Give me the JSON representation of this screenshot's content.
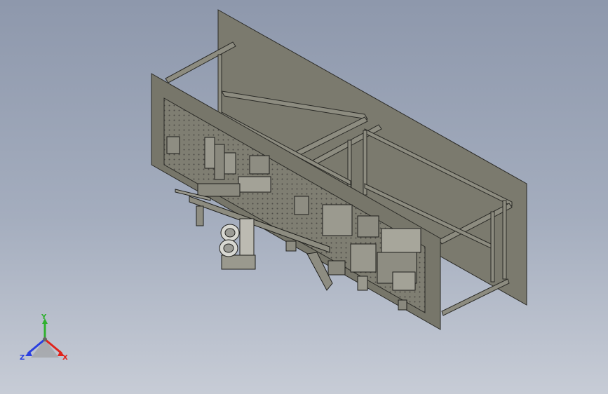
{
  "viewport": {
    "background_top": "#8e98ac",
    "background_bottom": "#c7ccd6"
  },
  "model": {
    "panel_color": "#77766a",
    "frame_color": "#8a897d",
    "edge_color": "#2a2a26"
  },
  "triad": {
    "icon": "orientation-triad-icon",
    "x_label": "X",
    "y_label": "Y",
    "z_label": "Z",
    "x_color": "#e0241b",
    "y_color": "#2fb12f",
    "z_color": "#2a3fe0"
  }
}
